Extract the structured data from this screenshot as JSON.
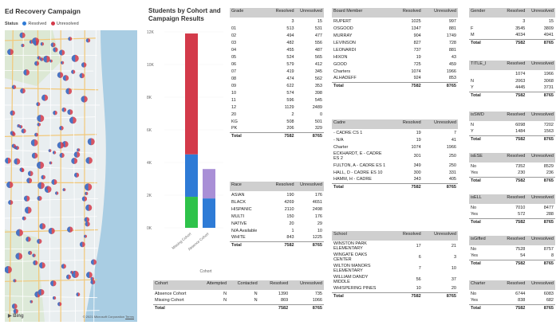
{
  "map_panel": {
    "title": "Ed Recovery Campaign",
    "legend_label": "Status",
    "legend_resolved": "Resolved",
    "legend_unresolved": "Unresolved",
    "resolved_color": "#2e7bd6",
    "unresolved_color": "#d33a4a",
    "copyright": "© 2021 Microsoft Corporation",
    "terms": "Terms",
    "bing": "Bing"
  },
  "chart_title": "Students by Cohort and Campaign Results",
  "chart_data": {
    "type": "bar",
    "title": "Students by Cohort and Campaign Results",
    "xlabel": "Cohort",
    "categories": [
      "Missing Cohort",
      "Absence Cohort"
    ],
    "y_ticks": [
      "12K",
      "10K",
      "8K",
      "6K",
      "4K",
      "2K",
      "0K"
    ],
    "ylim": [
      0,
      12000
    ],
    "series": [
      {
        "name": "",
        "color": "#d33a4a",
        "values": [
          7400,
          0
        ]
      },
      {
        "name": "",
        "color": "#2e7bd6",
        "values": [
          2600,
          1800
        ]
      },
      {
        "name": "",
        "color": "#2ec24a",
        "values": [
          1900,
          0
        ]
      },
      {
        "name": "",
        "color": "#a98fd6",
        "values": [
          0,
          1800
        ]
      }
    ]
  },
  "grade_table": {
    "headers": [
      "Grade",
      "Resolved",
      "Unresolved"
    ],
    "rows": [
      [
        "",
        "3",
        "15"
      ],
      [
        "01",
        "513",
        "531"
      ],
      [
        "02",
        "494",
        "477"
      ],
      [
        "03",
        "482",
        "556"
      ],
      [
        "04",
        "455",
        "487"
      ],
      [
        "05",
        "524",
        "565"
      ],
      [
        "06",
        "579",
        "412"
      ],
      [
        "07",
        "419",
        "345"
      ],
      [
        "08",
        "474",
        "562"
      ],
      [
        "09",
        "622",
        "353"
      ],
      [
        "10",
        "574",
        "398"
      ],
      [
        "11",
        "596",
        "545"
      ],
      [
        "12",
        "1129",
        "2489"
      ],
      [
        "20",
        "2",
        "0"
      ],
      [
        "KG",
        "508",
        "501"
      ],
      [
        "PK",
        "206",
        "329"
      ],
      [
        "Total",
        "7582",
        "8765"
      ]
    ]
  },
  "race_table": {
    "headers": [
      "Race",
      "Resolved",
      "Unresolved"
    ],
    "rows": [
      [
        "ASIAN",
        "190",
        "176"
      ],
      [
        "BLACK",
        "4269",
        "4651"
      ],
      [
        "HISPANIC",
        "2110",
        "2498"
      ],
      [
        "MULTI",
        "150",
        "176"
      ],
      [
        "NATIVE",
        "20",
        "29"
      ],
      [
        "N/A Available",
        "1",
        "10"
      ],
      [
        "WHITE",
        "843",
        "1225"
      ],
      [
        "Total",
        "7582",
        "8765"
      ]
    ]
  },
  "cohort_table": {
    "headers": [
      "Cohort",
      "Attempted",
      "Contacted",
      "Resolved",
      "Unresolved"
    ],
    "rows": [
      [
        "Absence Cohort",
        "N",
        "N",
        "1390",
        "735"
      ],
      [
        "Missing Cohort",
        "N",
        "N",
        "869",
        "1066"
      ],
      [
        "Total",
        "",
        "",
        "7582",
        "8765"
      ]
    ]
  },
  "board_table": {
    "headers": [
      "Board Member",
      "Resolved",
      "Unresolved"
    ],
    "rows": [
      [
        "RUPERT",
        "1025",
        "997"
      ],
      [
        "OSGOOD",
        "1347",
        "881"
      ],
      [
        "MURRAY",
        "904",
        "1749"
      ],
      [
        "LEVINSON",
        "827",
        "728"
      ],
      [
        "LEONARDI",
        "737",
        "881"
      ],
      [
        "HIXON",
        "19",
        "43"
      ],
      [
        "GOOD",
        "725",
        "459"
      ],
      [
        "Charters",
        "1074",
        "1966"
      ],
      [
        "ALHADEFF",
        "924",
        "853"
      ],
      [
        "Total",
        "7582",
        "8765"
      ]
    ]
  },
  "cadre_table": {
    "headers": [
      "Cadre",
      "Resolved",
      "Unresolved"
    ],
    "rows": [
      [
        "- CADRE CS 1",
        "19",
        "7"
      ],
      [
        "- N/A",
        "19",
        "41"
      ],
      [
        "Charter",
        "1074",
        "1966"
      ],
      [
        "ECKHARDT, E - CADRE ES 2",
        "301",
        "250"
      ],
      [
        "FULTON, A - CADRE ES 1",
        "349",
        "250"
      ],
      [
        "HALL, D - CADRE ES 10",
        "300",
        "331"
      ],
      [
        "HAMM, H - CADRE",
        "343",
        "405"
      ],
      [
        "Total",
        "7582",
        "8765"
      ]
    ]
  },
  "school_table": {
    "headers": [
      "School",
      "Resolved",
      "Unresolved"
    ],
    "rows": [
      [
        "WINSTON PARK ELEMENTARY",
        "17",
        "21"
      ],
      [
        "WINGATE OAKS CENTER",
        "6",
        "3"
      ],
      [
        "WILTON MANORS ELEMENTARY",
        "7",
        "10"
      ],
      [
        "WILLIAM DANDY MIDDLE",
        "56",
        "37"
      ],
      [
        "WHISPERING PINES",
        "10",
        "20"
      ],
      [
        "Total",
        "7582",
        "8765"
      ]
    ]
  },
  "gender_table": {
    "headers": [
      "Gender",
      "Resolved",
      "Unresolved"
    ],
    "rows": [
      [
        "",
        "3",
        "15"
      ],
      [
        "F",
        "3545",
        "3809"
      ],
      [
        "M",
        "4034",
        "4941"
      ],
      [
        "Total",
        "7582",
        "8765"
      ]
    ]
  },
  "title_table": {
    "headers": [
      "TITLE_I",
      "Resolved",
      "Unresolved"
    ],
    "rows": [
      [
        "",
        "1074",
        "1966"
      ],
      [
        "N",
        "2063",
        "3068"
      ],
      [
        "Y",
        "4445",
        "3731"
      ],
      [
        "Total",
        "7582",
        "8765"
      ]
    ]
  },
  "swd_table": {
    "headers": [
      "isSWD",
      "Resolved",
      "Unresolved"
    ],
    "rows": [
      [
        "N",
        "6098",
        "7202"
      ],
      [
        "Y",
        "1484",
        "1563"
      ],
      [
        "Total",
        "7582",
        "8765"
      ]
    ]
  },
  "ese_table": {
    "headers": [
      "isESE",
      "Resolved",
      "Unresolved"
    ],
    "rows": [
      [
        "No",
        "7352",
        "8529"
      ],
      [
        "Yes",
        "230",
        "236"
      ],
      [
        "Total",
        "7582",
        "8765"
      ]
    ]
  },
  "ell_table": {
    "headers": [
      "isELL",
      "Resolved",
      "Unresolved"
    ],
    "rows": [
      [
        "No",
        "7010",
        "8477"
      ],
      [
        "Yes",
        "572",
        "288"
      ],
      [
        "Total",
        "7582",
        "8765"
      ]
    ]
  },
  "gifted_table": {
    "headers": [
      "isGifted",
      "Resolved",
      "Unresolved"
    ],
    "rows": [
      [
        "No",
        "7528",
        "8757"
      ],
      [
        "Yes",
        "54",
        "8"
      ],
      [
        "Total",
        "7582",
        "8765"
      ]
    ]
  },
  "charter_table": {
    "headers": [
      "Charter",
      "Resolved",
      "Unresolved"
    ],
    "rows": [
      [
        "No",
        "6744",
        "6083"
      ],
      [
        "Yes",
        "838",
        "682"
      ],
      [
        "Total",
        "7582",
        "8765"
      ]
    ]
  }
}
